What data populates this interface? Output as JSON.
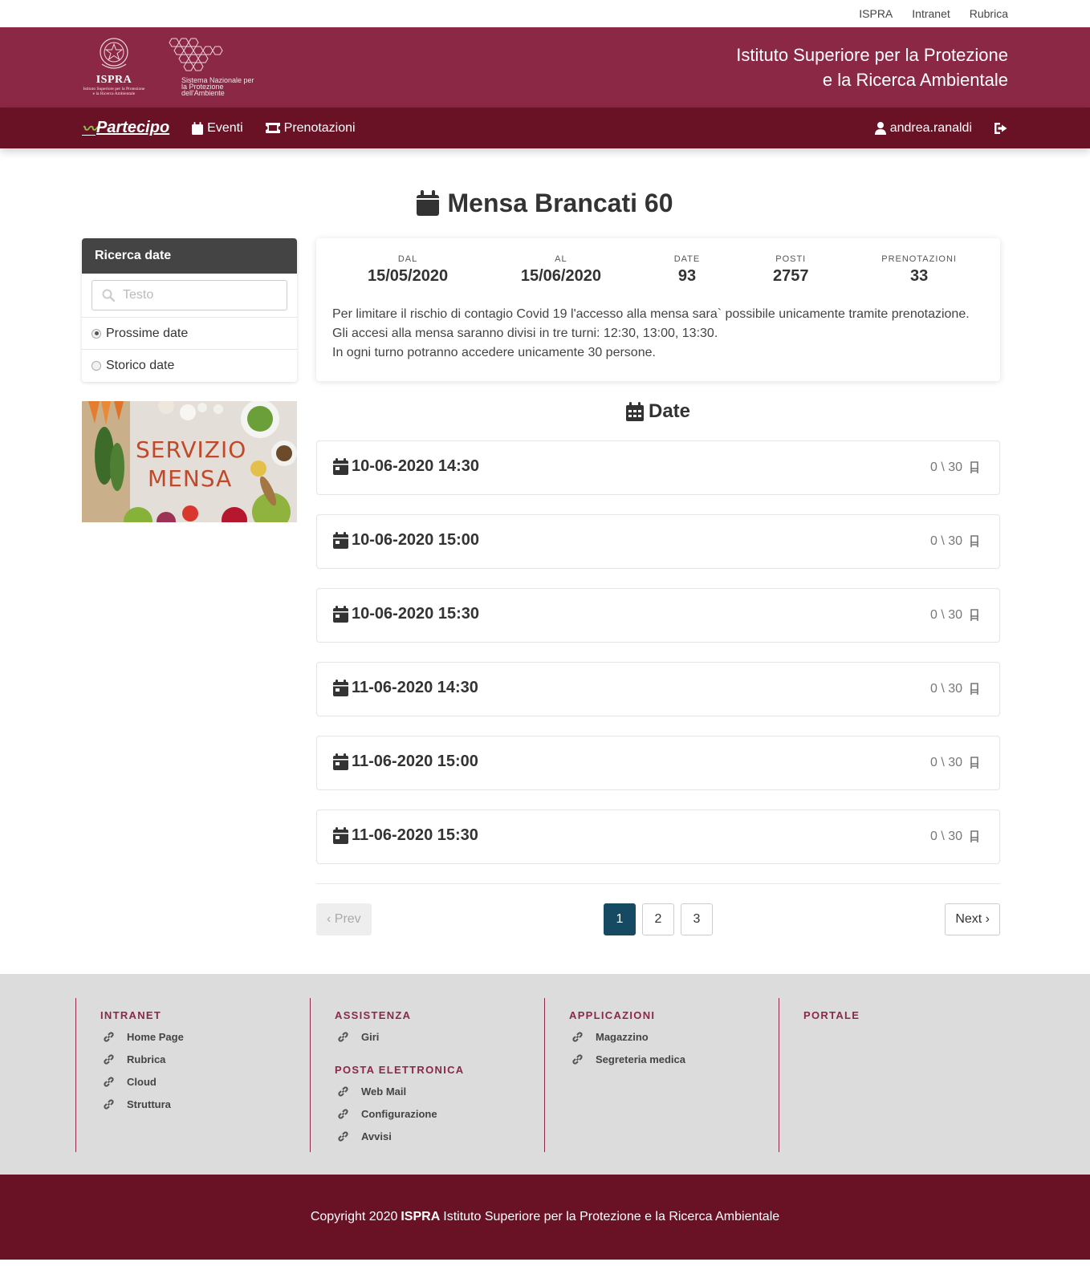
{
  "topbar": {
    "links": [
      "ISPRA",
      "Intranet",
      "Rubrica"
    ]
  },
  "header": {
    "logo_ispra_text": "ISPRA",
    "logo_ispra_sub": "Istituto Superiore per la Protezione e la Ricerca Ambientale",
    "logo_snpa_text": "Sistema Nazionale per la Protezione dell'Ambiente",
    "institute_line1": "Istituto Superiore per la Protezione",
    "institute_line2": "e la Ricerca Ambientale"
  },
  "navbar": {
    "brand": "Partecipo",
    "eventi": "Eventi",
    "prenotazioni": "Prenotazioni",
    "user": "andrea.ranaldi"
  },
  "page": {
    "title": "Mensa Brancati 60"
  },
  "sidebar": {
    "search_title": "Ricerca date",
    "search_placeholder": "Testo",
    "radio_prossime": "Prossime date",
    "radio_storico": "Storico date",
    "selected": "Prossime date",
    "image_text_1": "SERVIZIO",
    "image_text_2": "MENSA"
  },
  "info": {
    "dal_label": "DAL",
    "dal_value": "15/05/2020",
    "al_label": "AL",
    "al_value": "15/06/2020",
    "date_label": "DATE",
    "date_value": "93",
    "posti_label": "POSTI",
    "posti_value": "2757",
    "pren_label": "PRENOTAZIONI",
    "pren_value": "33",
    "desc_line1": "Per limitare il rischio di contagio Covid 19 l'accesso alla mensa sara` possibile unicamente tramite prenotazione.",
    "desc_line2": "Gli accesi alla mensa saranno divisi in tre turni: 12:30, 13:00, 13:30.",
    "desc_line3": "In ogni turno potranno accedere unicamente 30 persone."
  },
  "dates_section": {
    "title": "Date",
    "items": [
      {
        "datetime": "10-06-2020 14:30",
        "seats": "0 \\ 30"
      },
      {
        "datetime": "10-06-2020 15:00",
        "seats": "0 \\ 30"
      },
      {
        "datetime": "10-06-2020 15:30",
        "seats": "0 \\ 30"
      },
      {
        "datetime": "11-06-2020 14:30",
        "seats": "0 \\ 30"
      },
      {
        "datetime": "11-06-2020 15:00",
        "seats": "0 \\ 30"
      },
      {
        "datetime": "11-06-2020 15:30",
        "seats": "0 \\ 30"
      }
    ]
  },
  "pagination": {
    "prev": "‹ Prev",
    "next": "Next ›",
    "pages": [
      "1",
      "2",
      "3"
    ],
    "current": "1"
  },
  "footer": {
    "intranet": {
      "heading": "INTRANET",
      "links": [
        "Home Page",
        "Rubrica",
        "Cloud",
        "Struttura"
      ]
    },
    "assistenza": {
      "heading": "ASSISTENZA",
      "links": [
        "Giri"
      ]
    },
    "posta": {
      "heading": "POSTA ELETTRONICA",
      "links": [
        "Web Mail",
        "Configurazione",
        "Avvisi"
      ]
    },
    "applicazioni": {
      "heading": "APPLICAZIONI",
      "links": [
        "Magazzino",
        "Segreteria medica"
      ]
    },
    "portale": {
      "heading": "PORTALE"
    },
    "copyright_pre": "Copyright 2020",
    "copyright_bold": "ISPRA",
    "copyright_post": "Istituto Superiore per la Protezione e la Ricerca Ambientale"
  },
  "colors": {
    "header_bg": "#8b2846",
    "navbar_bg": "#691125",
    "active_page": "#164a63",
    "footer_bg": "#dcdcdc"
  },
  "icons": [
    "calendar-icon",
    "ticket-icon",
    "user-icon",
    "logout-icon",
    "search-icon",
    "chair-icon",
    "link-icon"
  ]
}
